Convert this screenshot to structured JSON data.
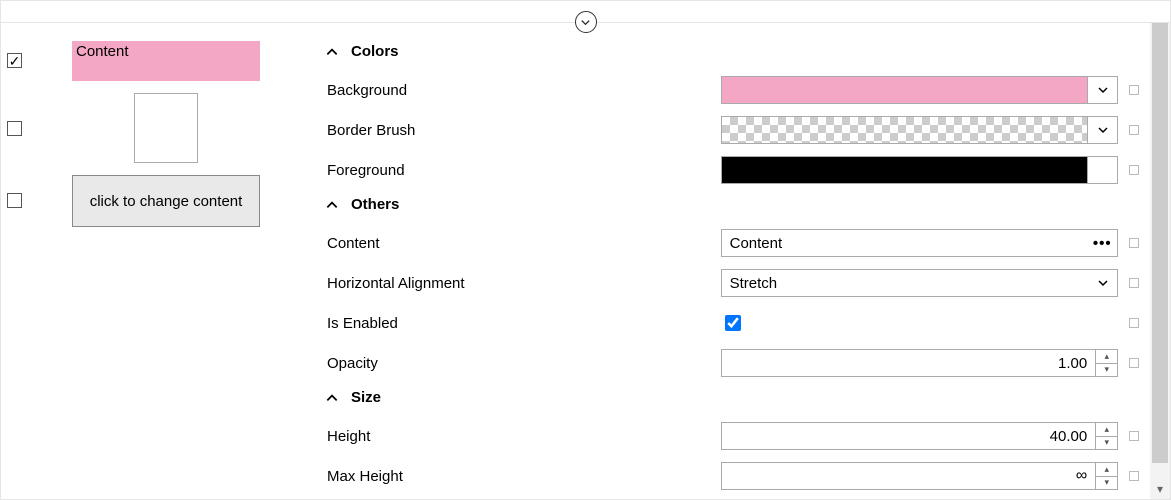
{
  "previews": {
    "item1": {
      "checked": true,
      "label": "Content",
      "background": "#f4a6c5"
    },
    "item2": {
      "checked": false
    },
    "item3": {
      "checked": false,
      "label": "click to change content"
    }
  },
  "sections": {
    "colors": {
      "title": "Colors",
      "props": {
        "background": {
          "label": "Background",
          "value": "#f4a6c5"
        },
        "border_brush": {
          "label": "Border Brush",
          "value": "transparent"
        },
        "foreground": {
          "label": "Foreground",
          "value": "#000000"
        }
      }
    },
    "others": {
      "title": "Others",
      "props": {
        "content": {
          "label": "Content",
          "value": "Content"
        },
        "horizontal_alignment": {
          "label": "Horizontal Alignment",
          "value": "Stretch"
        },
        "is_enabled": {
          "label": "Is Enabled",
          "value": true
        },
        "opacity": {
          "label": "Opacity",
          "value": "1.00"
        }
      }
    },
    "size": {
      "title": "Size",
      "props": {
        "height": {
          "label": "Height",
          "value": "40.00"
        },
        "max_height": {
          "label": "Max Height",
          "value": "∞"
        }
      }
    }
  }
}
